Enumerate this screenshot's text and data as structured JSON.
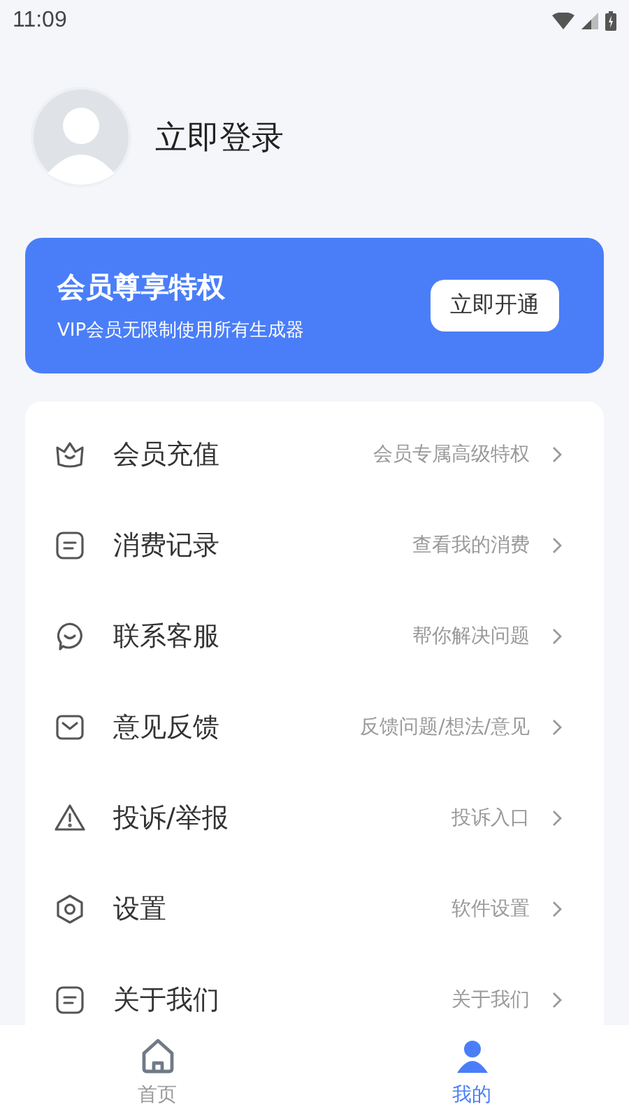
{
  "status_bar": {
    "time": "11:09"
  },
  "profile": {
    "login_label": "立即登录"
  },
  "vip_banner": {
    "title": "会员尊享特权",
    "subtitle": "VIP会员无限制使用所有生成器",
    "button": "立即开通"
  },
  "menu": [
    {
      "kind": "crown",
      "label": "会员充值",
      "hint": "会员专属高级特权"
    },
    {
      "kind": "note",
      "label": "消费记录",
      "hint": "查看我的消费"
    },
    {
      "kind": "chat",
      "label": "联系客服",
      "hint": "帮你解决问题"
    },
    {
      "kind": "mail",
      "label": "意见反馈",
      "hint": "反馈问题/想法/意见"
    },
    {
      "kind": "warning",
      "label": "投诉/举报",
      "hint": "投诉入口"
    },
    {
      "kind": "settings",
      "label": "设置",
      "hint": "软件设置"
    },
    {
      "kind": "note",
      "label": "关于我们",
      "hint": "关于我们"
    }
  ],
  "bottom_nav": [
    {
      "kind": "home",
      "label": "首页",
      "selected": false
    },
    {
      "kind": "person",
      "label": "我的",
      "selected": true
    }
  ]
}
